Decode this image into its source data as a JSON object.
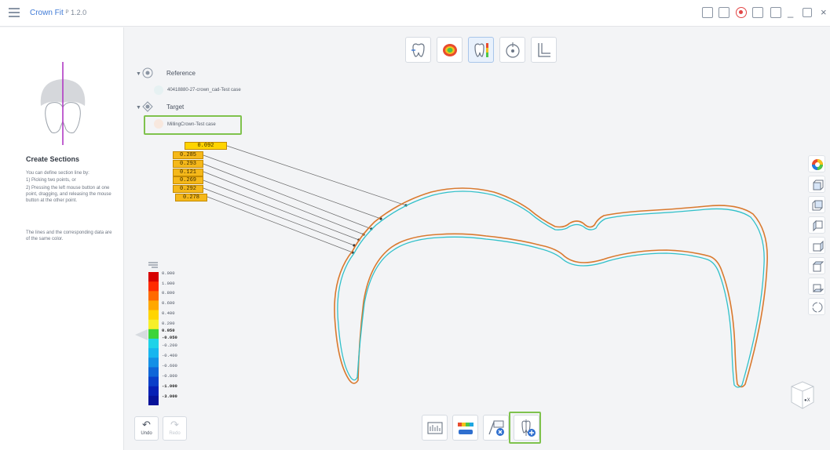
{
  "app": {
    "title": "Crown Fit",
    "version": "ᴾ 1.2.0"
  },
  "window_controls": {
    "minimize": "_",
    "close": "×"
  },
  "help": {
    "title": "Create Sections",
    "lines": [
      "You can define section line by:",
      "1) Picking two points, or",
      "2) Pressing the left mouse button at one point, dragging, and releasing the mouse button at the other point.",
      "The lines and the corresponding data are of the same color."
    ]
  },
  "layers": {
    "reference": {
      "label": "Reference",
      "file": "40418880-27-crown_cad-Test case"
    },
    "target": {
      "label": "Target",
      "file": "MillingCrown-Test case"
    }
  },
  "section_values": [
    "0.092",
    "0.285",
    "0.293",
    "0.121",
    "0.269",
    "0.292",
    "0.278"
  ],
  "legend": {
    "labels": [
      "0.000",
      "1.000",
      "0.800",
      "0.600",
      "0.400",
      "0.200",
      "0.050",
      "-0.050",
      "-0.200",
      "-0.400",
      "-0.600",
      "-0.800",
      "-1.000",
      "-3.000"
    ],
    "colors": [
      "#d60000",
      "#ff2b00",
      "#ff6a00",
      "#ffa800",
      "#ffd500",
      "#f7ef2a",
      "#3dd43a",
      "#1fd3e8",
      "#17b6ef",
      "#1390e6",
      "#0f66d8",
      "#0a3fc9",
      "#0620b5",
      "#061299"
    ]
  },
  "bottom": {
    "undo": "Undo",
    "redo": "Redo"
  },
  "colors": {
    "accent": "#3f7ad6",
    "highlight": "#7fc24d",
    "target_curve": "#d9792e",
    "reference_curve": "#2fc0c9"
  },
  "icons": {
    "top_toolbar": [
      "crown-view-icon",
      "heatmap-view-icon",
      "color-scale-icon",
      "deviation-point-icon",
      "section-view-icon"
    ],
    "bottom_toolbar": [
      "report-icon",
      "color-range-icon",
      "clear-sections-icon",
      "add-section-icon"
    ],
    "right_toolbar": [
      "color-wheel-icon",
      "view-front-icon",
      "view-back-icon",
      "view-left-icon",
      "view-right-icon",
      "view-top-icon",
      "view-bottom-icon",
      "reset-view-icon"
    ]
  }
}
